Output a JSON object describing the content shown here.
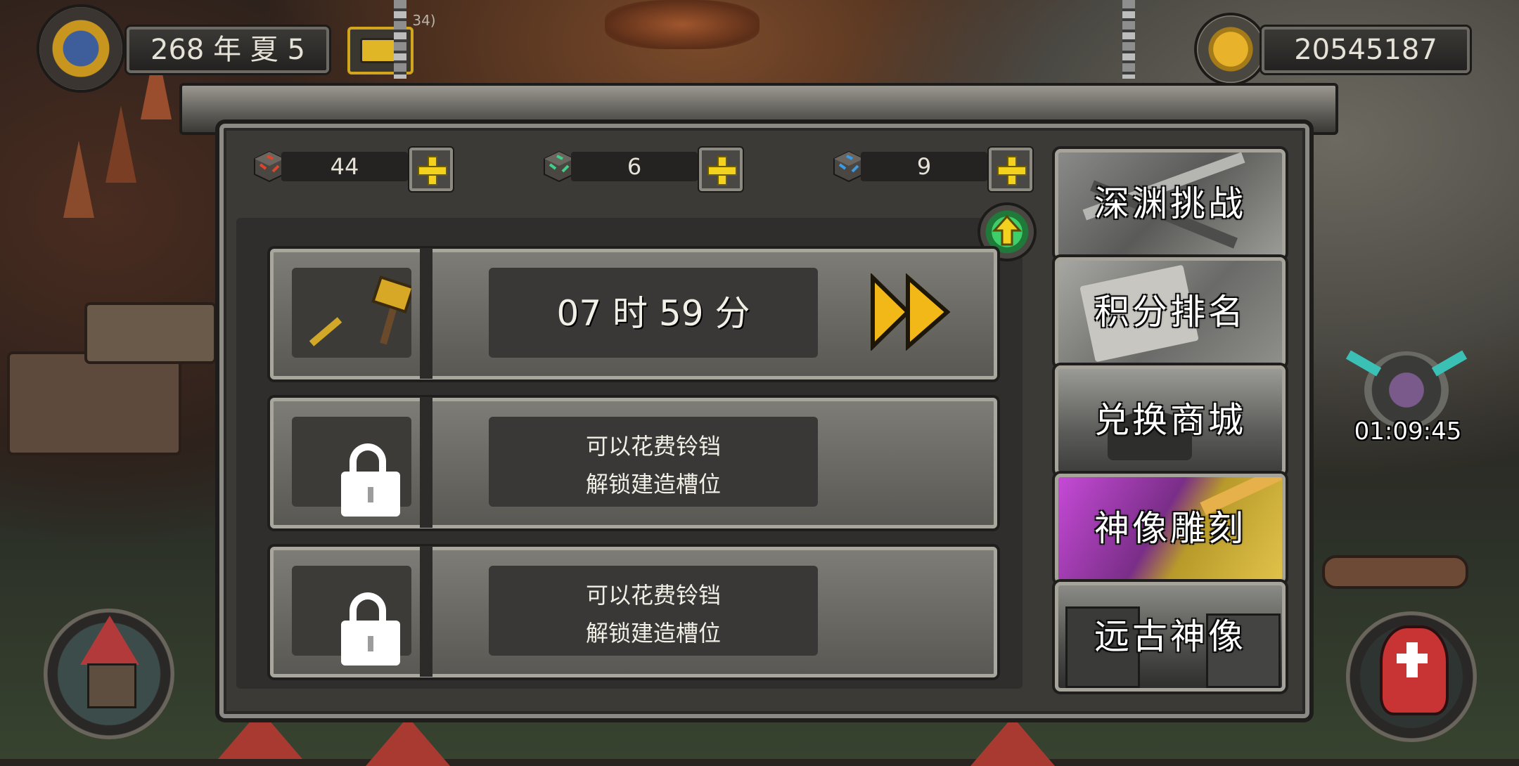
{
  "hud": {
    "date": "268 年 夏 5",
    "gold": "20545187",
    "tiny_label": "34)"
  },
  "currencies": [
    {
      "icon": "red-cube-icon",
      "count": "44"
    },
    {
      "icon": "green-cube-icon",
      "count": "6"
    },
    {
      "icon": "blue-cube-icon",
      "count": "9"
    }
  ],
  "slots": [
    {
      "type": "active",
      "timer": "07 时 59 分"
    },
    {
      "type": "locked",
      "line1": "可以花费铃铛",
      "line2": "解锁建造槽位"
    },
    {
      "type": "locked",
      "line1": "可以花费铃铛",
      "line2": "解锁建造槽位"
    }
  ],
  "side_buttons": [
    {
      "label": "深渊挑战",
      "theme": "#6f6f6f"
    },
    {
      "label": "积分排名",
      "theme": "#7a7a7a"
    },
    {
      "label": "兑换商城",
      "theme": "#737373"
    },
    {
      "label": "神像雕刻",
      "theme": "#9a40a8"
    },
    {
      "label": "远古神像",
      "theme": "#6a6a6a"
    }
  ],
  "event_timer": "01:09:45",
  "colors": {
    "accent_yellow": "#f2c418",
    "panel": "#3b3a37"
  }
}
